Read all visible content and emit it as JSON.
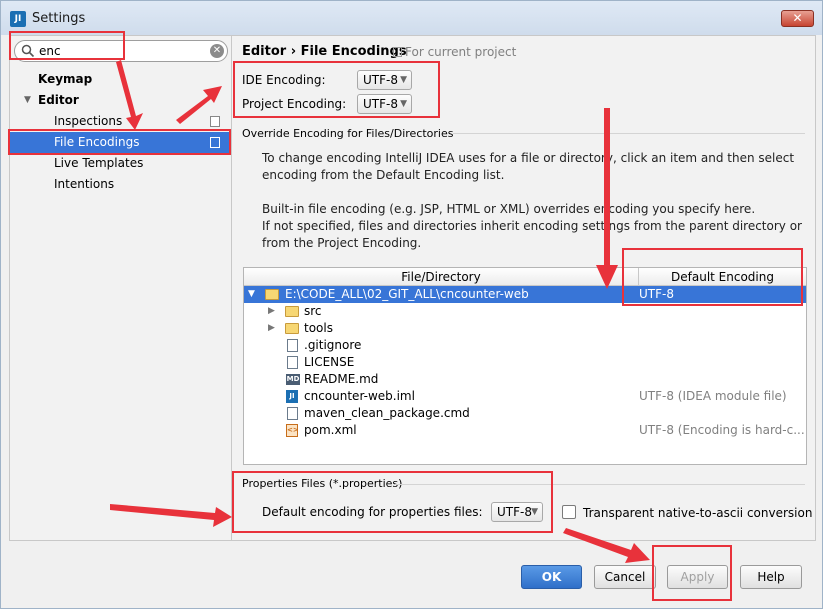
{
  "window": {
    "title": "Settings",
    "app_icon": "intellij-icon",
    "close_label": "✕"
  },
  "search": {
    "value": "enc"
  },
  "tree": [
    {
      "label": "Keymap",
      "bold": true
    },
    {
      "label": "Editor",
      "bold": true,
      "expanded": true
    },
    {
      "label": "Inspections"
    },
    {
      "label": "File Encodings",
      "selected": true
    },
    {
      "label": "Live Templates"
    },
    {
      "label": "Intentions"
    }
  ],
  "header": {
    "breadcrumb_parent": "Editor",
    "breadcrumb_sep": "›",
    "breadcrumb_current": "File Encodings",
    "scope_note": "For current project"
  },
  "ide_encoding": {
    "label": "IDE Encoding:",
    "value": "UTF-8"
  },
  "project_encoding": {
    "label": "Project Encoding:",
    "value": "UTF-8"
  },
  "override_section": {
    "title": "Override Encoding for Files/Directories",
    "para1_line1": "To change encoding IntelliJ IDEA uses for a file or directory, click an item and then select",
    "para1_line2": "encoding from the Default Encoding list.",
    "para2_line1": "Built-in file encoding (e.g. JSP, HTML or XML) overrides encoding you specify here.",
    "para2_line2": "If not specified, files and directories inherit encoding settings from the parent directory or",
    "para2_line3": "from the Project Encoding."
  },
  "table": {
    "columns": [
      "File/Directory",
      "Default Encoding"
    ],
    "rows": [
      {
        "name": "E:\\CODE_ALL\\02_GIT_ALL\\cncounter-web",
        "encoding": "UTF-8",
        "type": "folder",
        "level": 0,
        "expander": "▼",
        "selected": true
      },
      {
        "name": "src",
        "encoding": "",
        "type": "folder",
        "level": 1,
        "expander": "▶"
      },
      {
        "name": "tools",
        "encoding": "",
        "type": "folder",
        "level": 1,
        "expander": "▶"
      },
      {
        "name": ".gitignore",
        "encoding": "",
        "type": "file",
        "level": 1
      },
      {
        "name": "LICENSE",
        "encoding": "",
        "type": "file",
        "level": 1
      },
      {
        "name": "README.md",
        "encoding": "",
        "type": "md",
        "level": 1
      },
      {
        "name": "cncounter-web.iml",
        "encoding": "UTF-8 (IDEA module file)",
        "type": "iml",
        "level": 1
      },
      {
        "name": "maven_clean_package.cmd",
        "encoding": "",
        "type": "file",
        "level": 1
      },
      {
        "name": "pom.xml",
        "encoding": "UTF-8 (Encoding is hard-c...",
        "type": "xml",
        "level": 1
      }
    ]
  },
  "properties": {
    "section_title": "Properties Files (*.properties)",
    "default_label": "Default encoding for properties files:",
    "default_value": "UTF-8",
    "transparent_label": "Transparent native-to-ascii conversion",
    "transparent_checked": false
  },
  "buttons": {
    "ok": "OK",
    "cancel": "Cancel",
    "apply": "Apply",
    "help": "Help"
  },
  "colors": {
    "selection": "#3875d7",
    "annotation": "#e8323b"
  }
}
